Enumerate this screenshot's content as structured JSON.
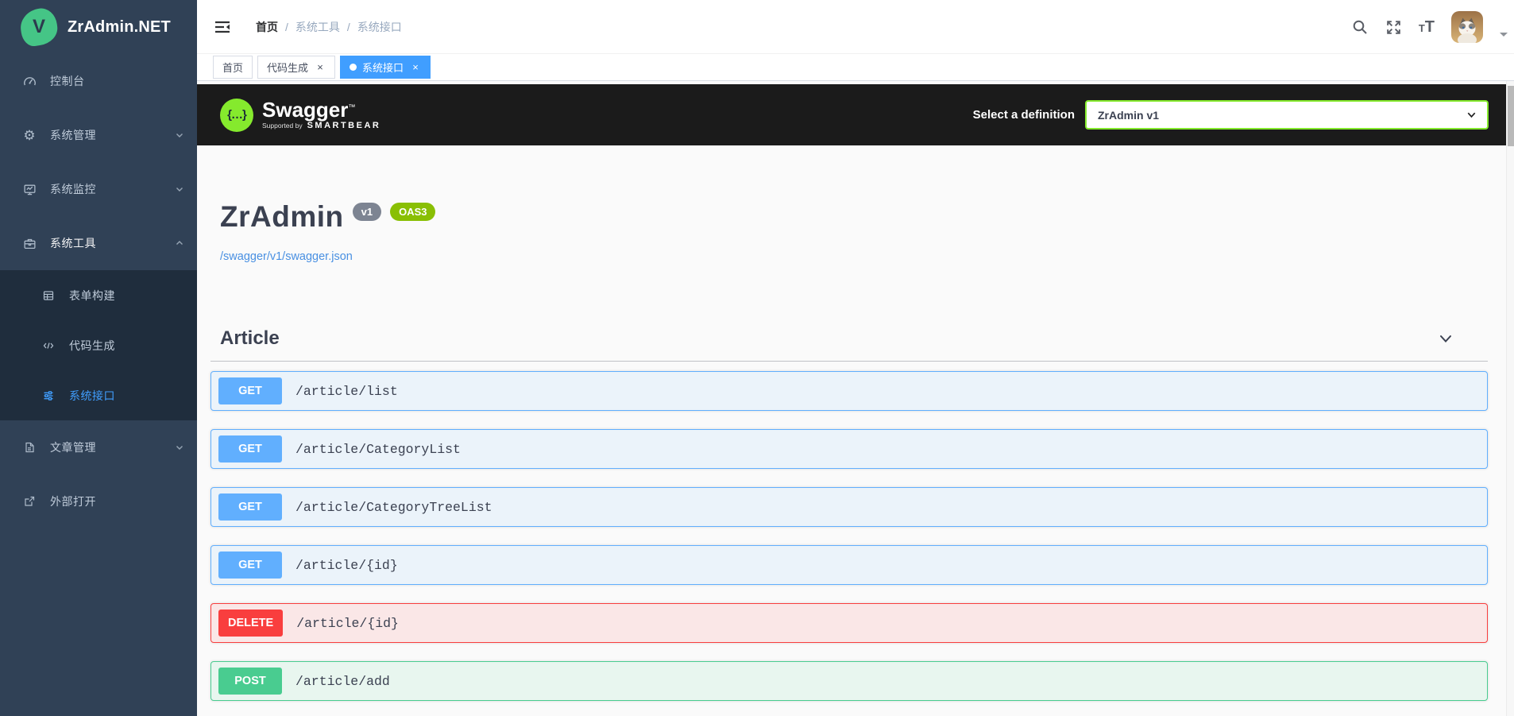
{
  "colors": {
    "accent": "#409eff",
    "sidebar_bg": "#304156",
    "submenu_bg": "#1f2d3d",
    "swagger_topbar_bg": "#1b1b1b",
    "swagger_green": "#85ea2d",
    "oas_badge_green": "#89bf04",
    "get_blue": "#61affe",
    "post_green": "#49cc90",
    "delete_red": "#f93e3e",
    "link_blue": "#4990e2"
  },
  "sidebar": {
    "logo_letter": "V",
    "logo_text": "ZrAdmin.NET",
    "items": [
      {
        "label": "控制台",
        "icon": "dashboard-icon"
      },
      {
        "label": "系统管理",
        "icon": "gear-icon",
        "chevron": "down"
      },
      {
        "label": "系统监控",
        "icon": "monitor-icon",
        "chevron": "down"
      },
      {
        "label": "系统工具",
        "icon": "toolbox-icon",
        "chevron": "up",
        "expanded": true
      },
      {
        "label": "文章管理",
        "icon": "document-icon",
        "chevron": "down"
      },
      {
        "label": "外部打开",
        "icon": "external-link-icon"
      }
    ],
    "submenu_items": [
      {
        "label": "表单构建",
        "icon": "table-icon"
      },
      {
        "label": "代码生成",
        "icon": "code-icon"
      },
      {
        "label": "系统接口",
        "icon": "sliders-icon",
        "active": true
      }
    ]
  },
  "header": {
    "breadcrumb": [
      "首页",
      "系统工具",
      "系统接口"
    ],
    "separator": "/"
  },
  "tabbar": {
    "tabs": [
      {
        "label": "首页"
      },
      {
        "label": "代码生成",
        "close": "×"
      },
      {
        "label": "系统接口",
        "close": "×",
        "active": true
      }
    ]
  },
  "swagger": {
    "topbar": {
      "logo_glyph": "{…}",
      "brand": "Swagger",
      "trademark": "™",
      "supported_by": "Supported by",
      "supporter": "SMARTBEAR",
      "select_label": "Select a definition",
      "selected_option": "ZrAdmin v1"
    },
    "info": {
      "title": "ZrAdmin",
      "version_badge": "v1",
      "oas_badge": "OAS3",
      "spec_link": "/swagger/v1/swagger.json"
    },
    "tag_section": {
      "title": "Article"
    },
    "operations": [
      {
        "method": "GET",
        "path": "/article/list"
      },
      {
        "method": "GET",
        "path": "/article/CategoryList"
      },
      {
        "method": "GET",
        "path": "/article/CategoryTreeList"
      },
      {
        "method": "GET",
        "path": "/article/{id}"
      },
      {
        "method": "DELETE",
        "path": "/article/{id}"
      },
      {
        "method": "POST",
        "path": "/article/add"
      }
    ]
  }
}
